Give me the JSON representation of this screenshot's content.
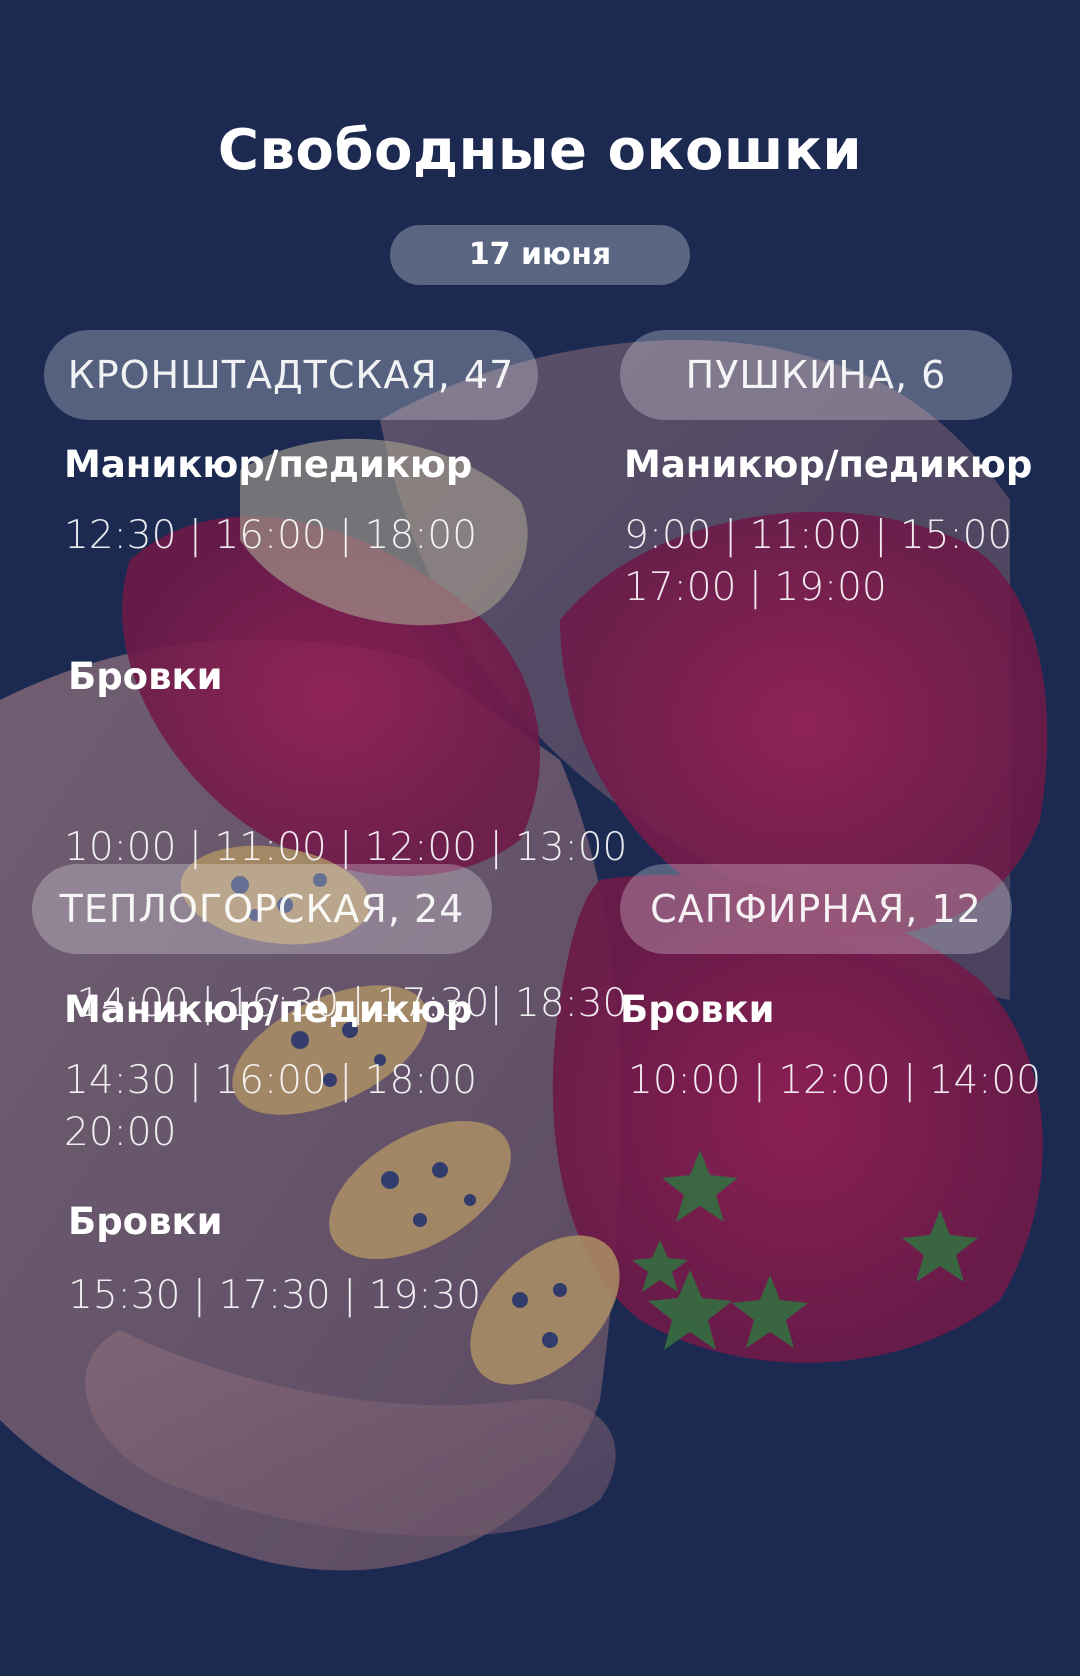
{
  "title": "Свободные окошки",
  "date": "17 июня",
  "locations": [
    {
      "address": "КРОНШТАДТСКАЯ, 47",
      "services": [
        {
          "name": "Маникюр/педикюр",
          "lines": [
            "12:30 | 16:00 | 18:00"
          ]
        },
        {
          "name": "Бровки",
          "lines": [
            "10:00 | 11:00 | 12:00 | 13:00",
            " 14:00 | 16:30 | 17:30| 18:30"
          ]
        }
      ]
    },
    {
      "address": "ПУШКИНА, 6",
      "services": [
        {
          "name": "Маникюр/педикюр",
          "lines": [
            "9:00 | 11:00 | 15:00",
            "17:00 | 19:00"
          ]
        }
      ]
    },
    {
      "address": "ТЕПЛОГОРСКАЯ, 24",
      "services": [
        {
          "name": "Маникюр/педикюр",
          "lines": [
            "14:30 | 16:00 | 18:00",
            "20:00"
          ]
        },
        {
          "name": "Бровки",
          "lines": [
            "15:30 | 17:30 | 19:30"
          ]
        }
      ]
    },
    {
      "address": "САПФИРНАЯ, 12",
      "services": [
        {
          "name": "Бровки",
          "lines": [
            "10:00 | 12:00 | 14:00"
          ]
        }
      ]
    }
  ]
}
